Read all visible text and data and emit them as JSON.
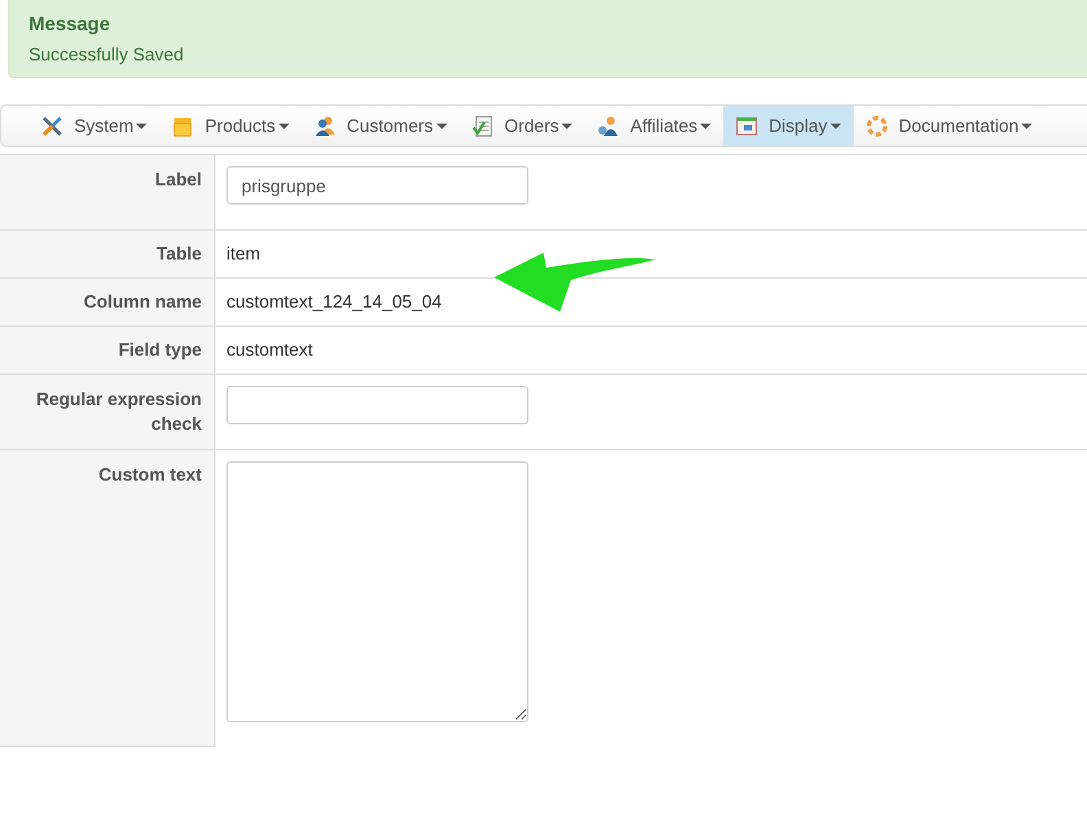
{
  "message": {
    "title": "Message",
    "text": "Successfully Saved"
  },
  "menu": [
    {
      "label": "System",
      "selected": false
    },
    {
      "label": "Products",
      "selected": false
    },
    {
      "label": "Customers",
      "selected": false
    },
    {
      "label": "Orders",
      "selected": false
    },
    {
      "label": "Affiliates",
      "selected": false
    },
    {
      "label": "Display",
      "selected": true
    },
    {
      "label": "Documentation",
      "selected": false
    }
  ],
  "form": [
    {
      "label": "Label",
      "kind": "input",
      "value": "prisgruppe"
    },
    {
      "label": "Table",
      "kind": "text",
      "value": "item"
    },
    {
      "label": "Column name",
      "kind": "text",
      "value": "customtext_124_14_05_04"
    },
    {
      "label": "Field type",
      "kind": "text",
      "value": "customtext"
    },
    {
      "label": "Regular expression check",
      "kind": "input"
    },
    {
      "label": "Custom text",
      "kind": "textarea"
    }
  ]
}
